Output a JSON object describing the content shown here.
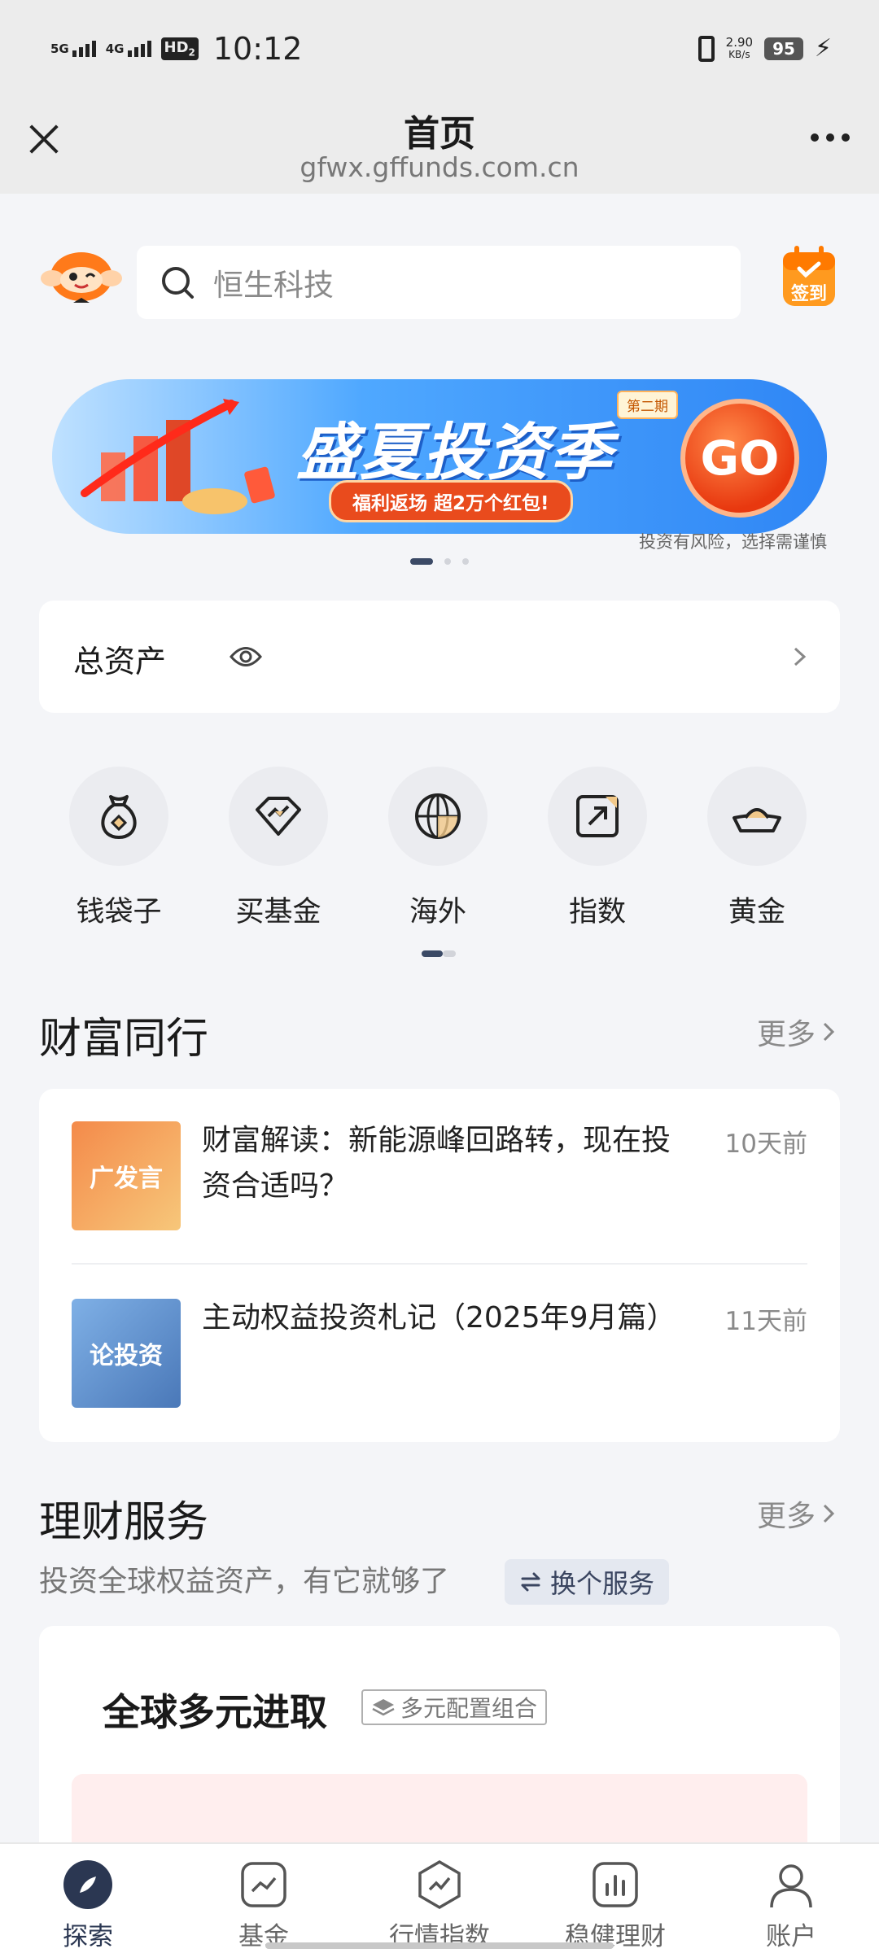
{
  "status_bar": {
    "net1": "5G",
    "net2": "4G",
    "hd": "HD",
    "hd_sub": "2",
    "time": "10:12",
    "speed_value": "2.90",
    "speed_unit": "KB/s",
    "battery": "95"
  },
  "header": {
    "title": "首页",
    "url": "gfwx.gffunds.com.cn"
  },
  "search": {
    "placeholder": "恒生科技"
  },
  "signin": {
    "label": "签到"
  },
  "banner": {
    "title": "盛夏投资季",
    "tag": "第二期",
    "subtitle": "福利返场 超2万个红包!",
    "go": "GO",
    "risk_note": "投资有风险，选择需谨慎"
  },
  "assets": {
    "label": "总资产"
  },
  "quick_menu": {
    "items": [
      {
        "label": "钱袋子",
        "icon": "money-bag-icon"
      },
      {
        "label": "买基金",
        "icon": "diamond-trend-icon"
      },
      {
        "label": "海外",
        "icon": "globe-icon"
      },
      {
        "label": "指数",
        "icon": "arrow-box-icon"
      },
      {
        "label": "黄金",
        "icon": "gold-ingot-icon"
      }
    ]
  },
  "wealth_section": {
    "title": "财富同行",
    "more": "更多",
    "articles": [
      {
        "thumb_text": "广发言",
        "title": "财富解读：新能源峰回路转，现在投资合适吗？",
        "time": "10天前"
      },
      {
        "thumb_text": "论投资",
        "title": "主动权益投资札记（2025年9月篇）",
        "time": "11天前"
      }
    ]
  },
  "service_section": {
    "title": "理财服务",
    "more": "更多",
    "subtitle": "投资全球权益资产，有它就够了",
    "switch": "换个服务",
    "card_title": "全球多元进取",
    "card_tag": "多元配置组合"
  },
  "bottom_nav": {
    "items": [
      {
        "label": "探索",
        "icon": "explore-icon",
        "active": true
      },
      {
        "label": "基金",
        "icon": "fund-chart-icon",
        "active": false
      },
      {
        "label": "行情指数",
        "icon": "market-index-icon",
        "active": false
      },
      {
        "label": "稳健理财",
        "icon": "bar-chart-icon",
        "active": false
      },
      {
        "label": "账户",
        "icon": "account-icon",
        "active": false
      }
    ]
  },
  "colors": {
    "accent": "#2b3752",
    "background": "#f4f5f8",
    "banner_blue": "#2f86f5",
    "go_orange": "#e8380f"
  }
}
